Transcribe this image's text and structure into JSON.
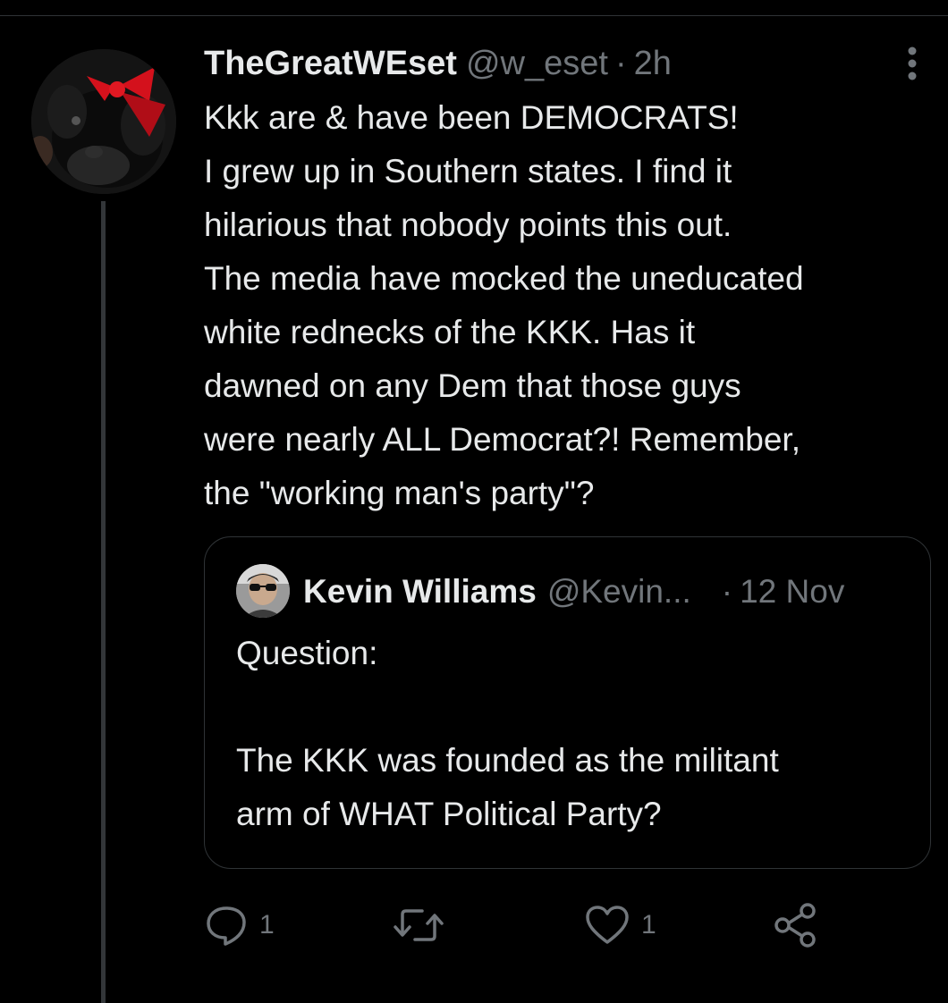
{
  "tweet": {
    "display_name": "TheGreatWEset",
    "handle": "@w_eset",
    "separator": "·",
    "time": "2h",
    "text_lines": [
      "Kkk are & have been DEMOCRATS!",
      "I grew up in Southern states. I find it",
      "hilarious that nobody points this out.",
      "The media have mocked the uneducated",
      "white rednecks of the KKK. Has it",
      "dawned on any Dem that those guys",
      "were nearly ALL Democrat?! Remember,",
      "the \"working man's party\"?"
    ]
  },
  "quote": {
    "display_name": "Kevin Williams",
    "handle": "@Kevin...",
    "separator": "·",
    "time": "12 Nov",
    "text_lines": [
      "Question:",
      "",
      "The KKK was founded as the militant",
      "arm of WHAT Political Party?"
    ]
  },
  "actions": {
    "reply_count": "1",
    "like_count": "1"
  },
  "icons": {
    "more": "more-vertical-icon",
    "reply": "reply-bubble-icon",
    "retweet": "retweet-icon",
    "like": "heart-icon",
    "share": "share-icon"
  },
  "colors": {
    "background": "#000000",
    "text": "#e7e9ea",
    "secondary": "#71767b",
    "border": "#2f3336",
    "bow": "#d4111c"
  }
}
